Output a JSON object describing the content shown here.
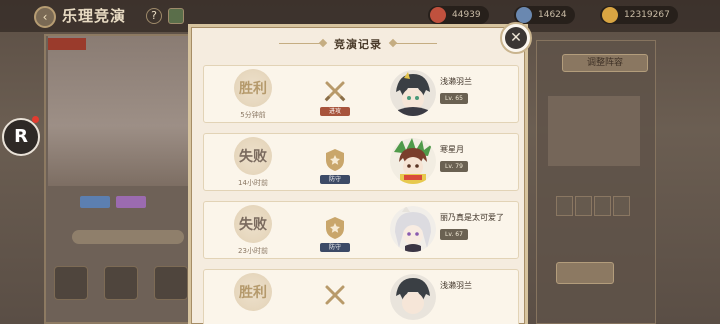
{
  "background": {
    "title": "乐理竞演",
    "help_icon": "?",
    "resources": [
      {
        "icon": "red-gem-icon",
        "value": "44939",
        "color": "#c0513e"
      },
      {
        "icon": "blue-crystal-icon",
        "value": "14624",
        "color": "#6a88b0"
      },
      {
        "icon": "gold-coin-icon",
        "value": "12319267",
        "color": "#d9a542"
      }
    ],
    "adjust_button": "调整阵容"
  },
  "modal": {
    "title": "竞演记录",
    "records": [
      {
        "result": "胜利",
        "result_type": "win",
        "time": "5分钟前",
        "mode": "进攻",
        "mode_type": "attack",
        "player": "浅濑羽兰",
        "level": "Lv. 65"
      },
      {
        "result": "失败",
        "result_type": "lose",
        "time": "14小时前",
        "mode": "防守",
        "mode_type": "defense",
        "player": "寒星月",
        "level": "Lv. 79"
      },
      {
        "result": "失败",
        "result_type": "lose",
        "time": "23小时前",
        "mode": "防守",
        "mode_type": "defense",
        "player": "丽乃真是太可爱了",
        "level": "Lv. 67"
      },
      {
        "result": "胜利",
        "result_type": "win",
        "time": "",
        "mode": "进攻",
        "mode_type": "attack",
        "player": "浅濑羽兰",
        "level": ""
      }
    ]
  },
  "colors": {
    "accent_gold": "#c5ad82",
    "attack_red": "#a8543c",
    "defense_blue": "#3c4a66",
    "panel_bg": "#f5ecdf"
  }
}
